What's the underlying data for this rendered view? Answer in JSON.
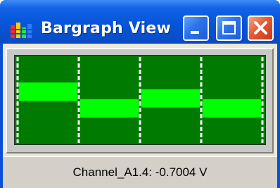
{
  "window": {
    "title": "Bargraph View",
    "icon": "bargraph-app-icon",
    "controls": [
      "minimize-icon",
      "maximize-icon",
      "close-icon"
    ]
  },
  "bargraph": {
    "channel_count": 4,
    "bar_levels": [
      0.6,
      0.4,
      0.52,
      0.4
    ],
    "bar_color": "#00ff00",
    "background_color": "#007a00",
    "separator_color": "#ffffff"
  },
  "status": {
    "text": "Channel_A1.4: -0.7004 V"
  },
  "colors": {
    "titlebar": "#0654d8",
    "close_button": "#e65a35",
    "client_background": "#ece9d8"
  }
}
